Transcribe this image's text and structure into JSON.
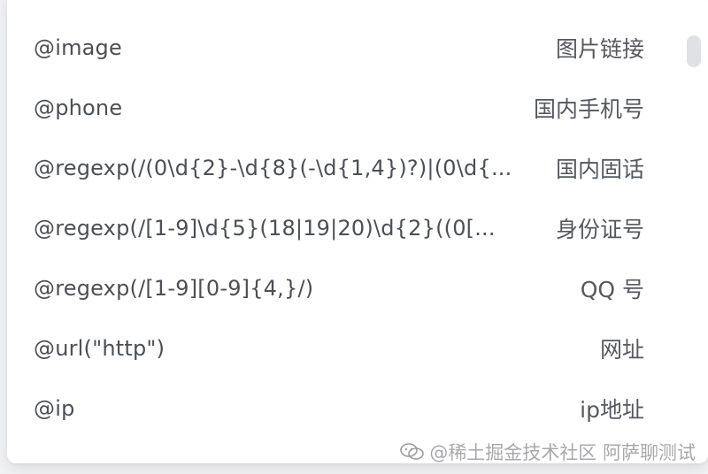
{
  "dropdown": {
    "items": [
      {
        "value": "@image",
        "label": "图片链接"
      },
      {
        "value": "@phone",
        "label": "国内手机号"
      },
      {
        "value": "@regexp(/(0\\d{2}-\\d{8}(-\\d{1,4})?)|(0\\d{...",
        "label": "国内固话"
      },
      {
        "value": "@regexp(/[1-9]\\d{5}(18|19|20)\\d{2}((0[...",
        "label": "身份证号"
      },
      {
        "value": "@regexp(/[1-9][0-9]{4,}/)",
        "label": "QQ 号"
      },
      {
        "value": "@url(\"http\")",
        "label": "网址"
      },
      {
        "value": "@ip",
        "label": "ip地址"
      }
    ]
  },
  "watermark": {
    "text": "@稀土掘金技术社区  阿萨聊测试",
    "icon": "wechat-icon"
  }
}
